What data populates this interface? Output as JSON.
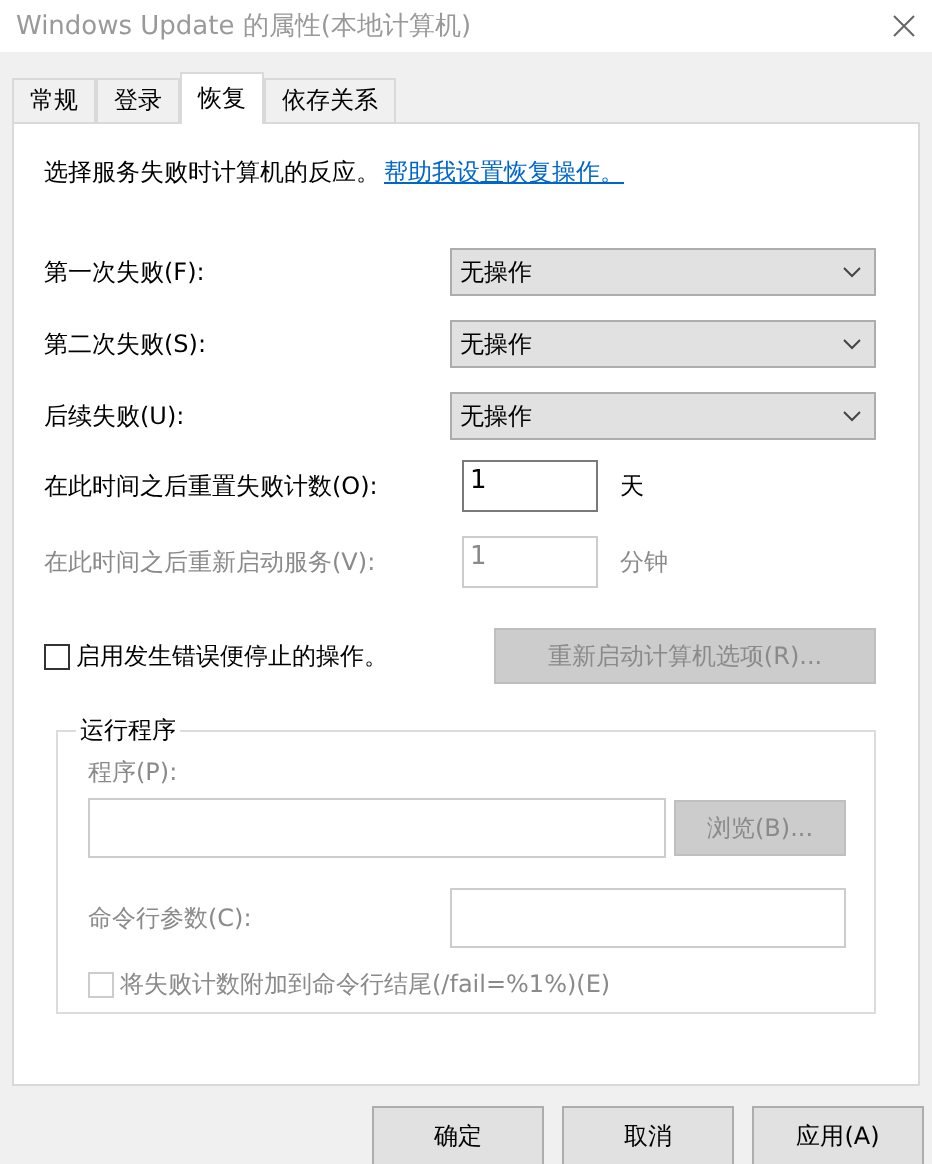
{
  "window": {
    "title": "Windows Update 的属性(本地计算机)"
  },
  "tabs": [
    {
      "label": "常规",
      "selected": false
    },
    {
      "label": "登录",
      "selected": false
    },
    {
      "label": "恢复",
      "selected": true
    },
    {
      "label": "依存关系",
      "selected": false
    }
  ],
  "description": "选择服务失败时计算机的反应。",
  "help_link": "帮助我设置恢复操作。",
  "failures": [
    {
      "label": "第一次失败(F):",
      "value": "无操作"
    },
    {
      "label": "第二次失败(S):",
      "value": "无操作"
    },
    {
      "label": "后续失败(U):",
      "value": "无操作"
    }
  ],
  "counters": [
    {
      "label": "在此时间之后重置失败计数(O):",
      "value": "1",
      "unit": "天",
      "disabled": false
    },
    {
      "label": "在此时间之后重新启动服务(V):",
      "value": "1",
      "unit": "分钟",
      "disabled": true
    }
  ],
  "stop_on_error": {
    "label": "启用发生错误便停止的操作。",
    "checked": false
  },
  "restart_options_button": {
    "label": "重新启动计算机选项(R)...",
    "disabled": true
  },
  "run_program": {
    "legend": "运行程序",
    "program_label": "程序(P):",
    "browse_button": "浏览(B)...",
    "params_label": "命令行参数(C):",
    "append_fail": {
      "label": "将失败计数附加到命令行结尾(/fail=%1%)(E)",
      "checked": false,
      "disabled": true
    }
  },
  "buttons": [
    "确定",
    "取消",
    "应用(A)"
  ]
}
